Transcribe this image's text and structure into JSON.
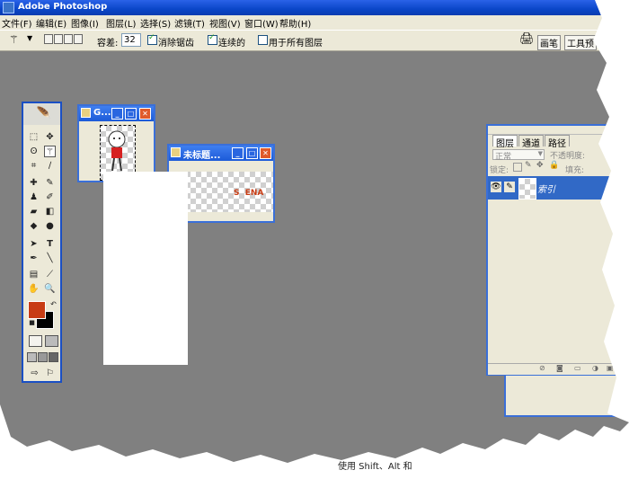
{
  "window": {
    "title": "Adobe Photoshop"
  },
  "menu": [
    "文件(F)",
    "编辑(E)",
    "图像(I)",
    "图层(L)",
    "选择(S)",
    "滤镜(T)",
    "视图(V)",
    "窗口(W)",
    "帮助(H)"
  ],
  "options": {
    "tolerance_label": "容差:",
    "tolerance_value": "32",
    "antialias_label": "消除锯齿",
    "contiguous_label": "连续的",
    "all_layers_label": "用于所有图层",
    "tab_brushes": "画笔",
    "tab_tools": "工具预"
  },
  "doc1": {
    "title": "G..."
  },
  "doc2": {
    "title": "未标题...",
    "content_text": "S  ENA"
  },
  "layers": {
    "tabs": [
      "图层",
      "通道",
      "路径"
    ],
    "mode": "正常",
    "opacity_label": "不透明度:",
    "lock_label": "锁定:",
    "fill_label": "填充:",
    "layer_name": "索引"
  },
  "status": {
    "hint": "使用 Shift、Alt 和"
  },
  "colors": {
    "foreground": "#c83c14",
    "background": "#000000",
    "canvas": "#808080"
  }
}
